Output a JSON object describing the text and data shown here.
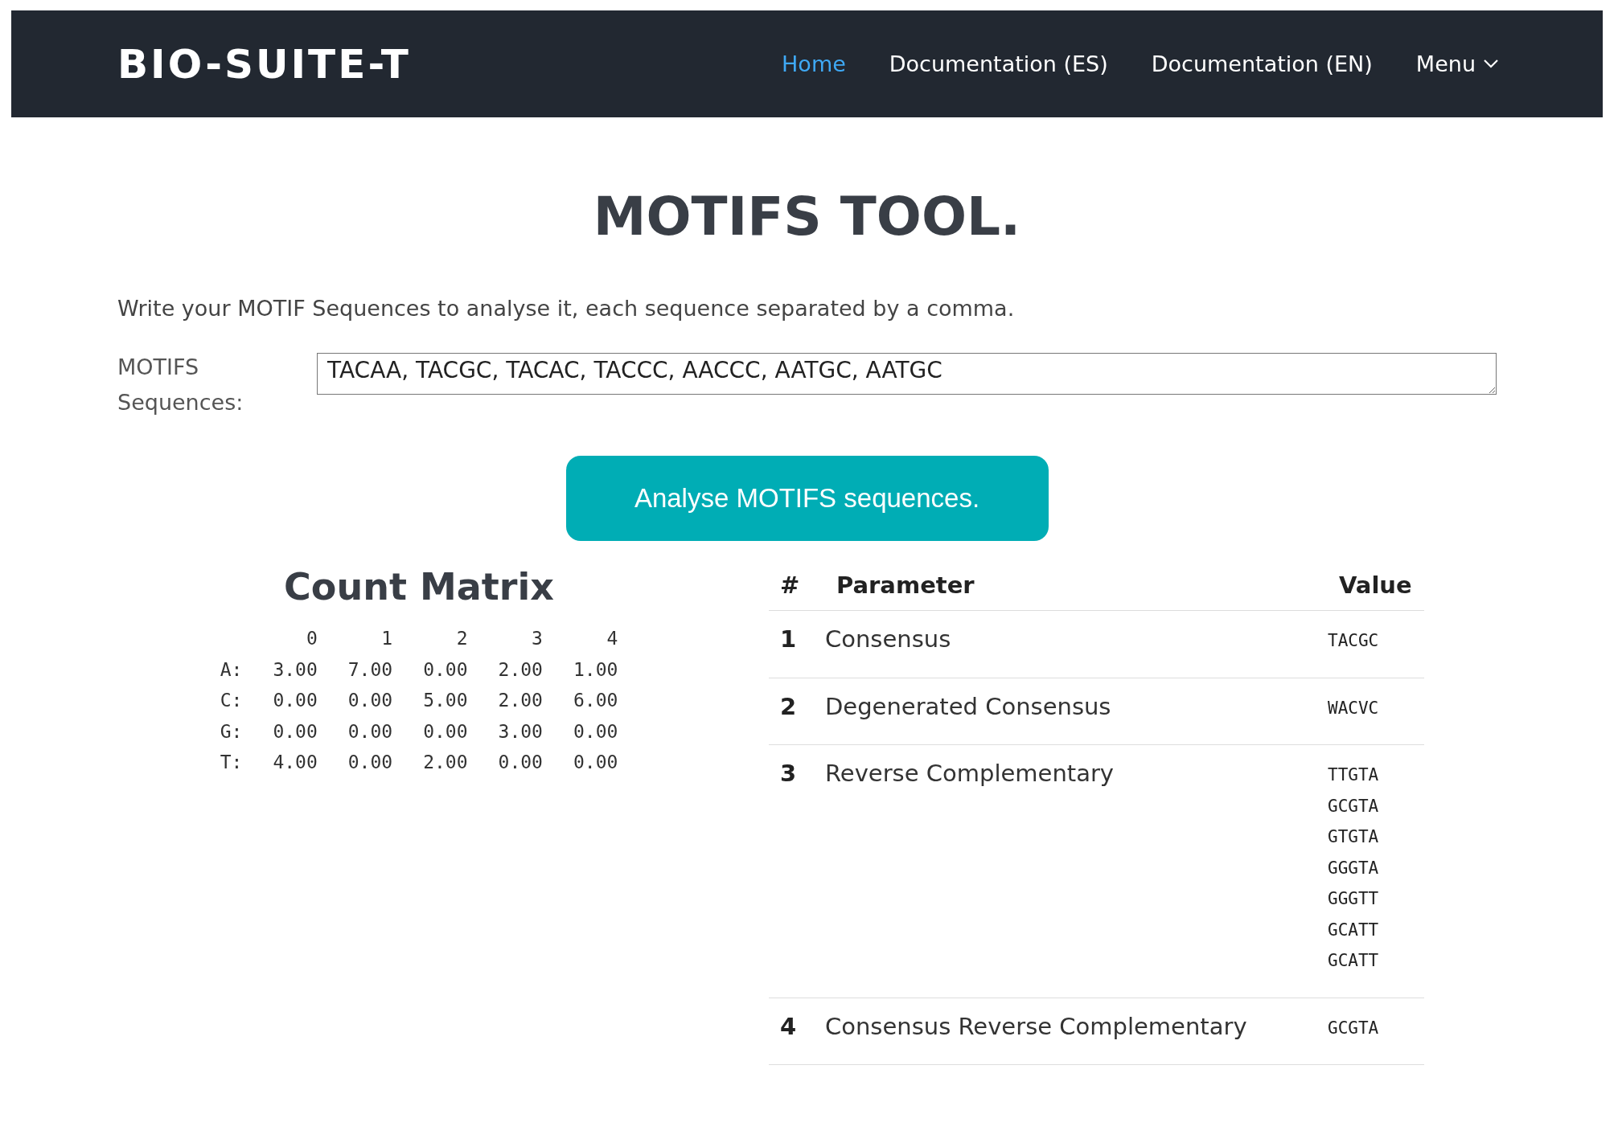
{
  "navbar": {
    "logo": "BIO-SUITE-T",
    "links": [
      {
        "label": "Home",
        "selected": true
      },
      {
        "label": "Documentation (ES)",
        "selected": false
      },
      {
        "label": "Documentation (EN)",
        "selected": false
      }
    ],
    "menu": {
      "label": "Menu"
    }
  },
  "title": "MOTIFS TOOL.",
  "instructions": "Write your MOTIF Sequences to analyse it, each sequence separated by a comma.",
  "input": {
    "label": "MOTIFS Sequences:",
    "value": "TACAA, TACGC, TACAC, TACCC, AACCC, AATGC, AATGC"
  },
  "button": "Analyse MOTIFS sequences.",
  "count_matrix": {
    "title": "Count Matrix",
    "columns": [
      "0",
      "1",
      "2",
      "3",
      "4"
    ],
    "rows": [
      {
        "label": "A:",
        "values": [
          "3.00",
          "7.00",
          "0.00",
          "2.00",
          "1.00"
        ]
      },
      {
        "label": "C:",
        "values": [
          "0.00",
          "0.00",
          "5.00",
          "2.00",
          "6.00"
        ]
      },
      {
        "label": "G:",
        "values": [
          "0.00",
          "0.00",
          "0.00",
          "3.00",
          "0.00"
        ]
      },
      {
        "label": "T:",
        "values": [
          "4.00",
          "0.00",
          "2.00",
          "0.00",
          "0.00"
        ]
      }
    ]
  },
  "results": {
    "columns": [
      "#",
      "Parameter",
      "Value"
    ],
    "rows": [
      {
        "number": "1",
        "parameter": "Consensus",
        "values": [
          "TACGC"
        ]
      },
      {
        "number": "2",
        "parameter": "Degenerated Consensus",
        "values": [
          "WACVC"
        ]
      },
      {
        "number": "3",
        "parameter": "Reverse Complementary",
        "values": [
          "TTGTA",
          "GCGTA",
          "GTGTA",
          "GGGTA",
          "GGGTT",
          "GCATT",
          "GCATT"
        ]
      },
      {
        "number": "4",
        "parameter": "Consensus Reverse Complementary",
        "values": [
          "GCGTA"
        ]
      }
    ]
  }
}
